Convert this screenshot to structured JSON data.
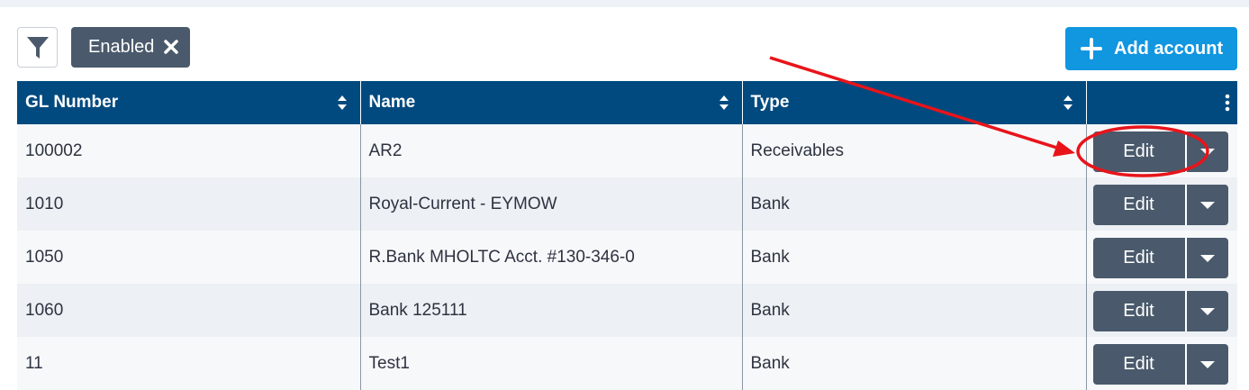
{
  "toolbar": {
    "filter_icon": "funnel-icon",
    "chip_label": "Enabled",
    "chip_close_icon": "close-icon",
    "add_label": "Add account",
    "add_icon": "plus-icon"
  },
  "table": {
    "columns": [
      "GL Number",
      "Name",
      "Type",
      ""
    ],
    "rows": [
      {
        "gl": "100002",
        "name": "AR2",
        "type": "Receivables",
        "action": "Edit"
      },
      {
        "gl": "1010",
        "name": "Royal-Current - EYMOW",
        "type": "Bank",
        "action": "Edit"
      },
      {
        "gl": "1050",
        "name": "R.Bank MHOLTC Acct. #130-346-0",
        "type": "Bank",
        "action": "Edit"
      },
      {
        "gl": "1060",
        "name": "Bank 125111",
        "type": "Bank",
        "action": "Edit"
      },
      {
        "gl": "11",
        "name": "Test1",
        "type": "Bank",
        "action": "Edit"
      }
    ]
  },
  "colors": {
    "header_bg": "#004a7f",
    "accent": "#1196e0",
    "button": "#4a5a6c",
    "annotation": "#e8141a"
  }
}
